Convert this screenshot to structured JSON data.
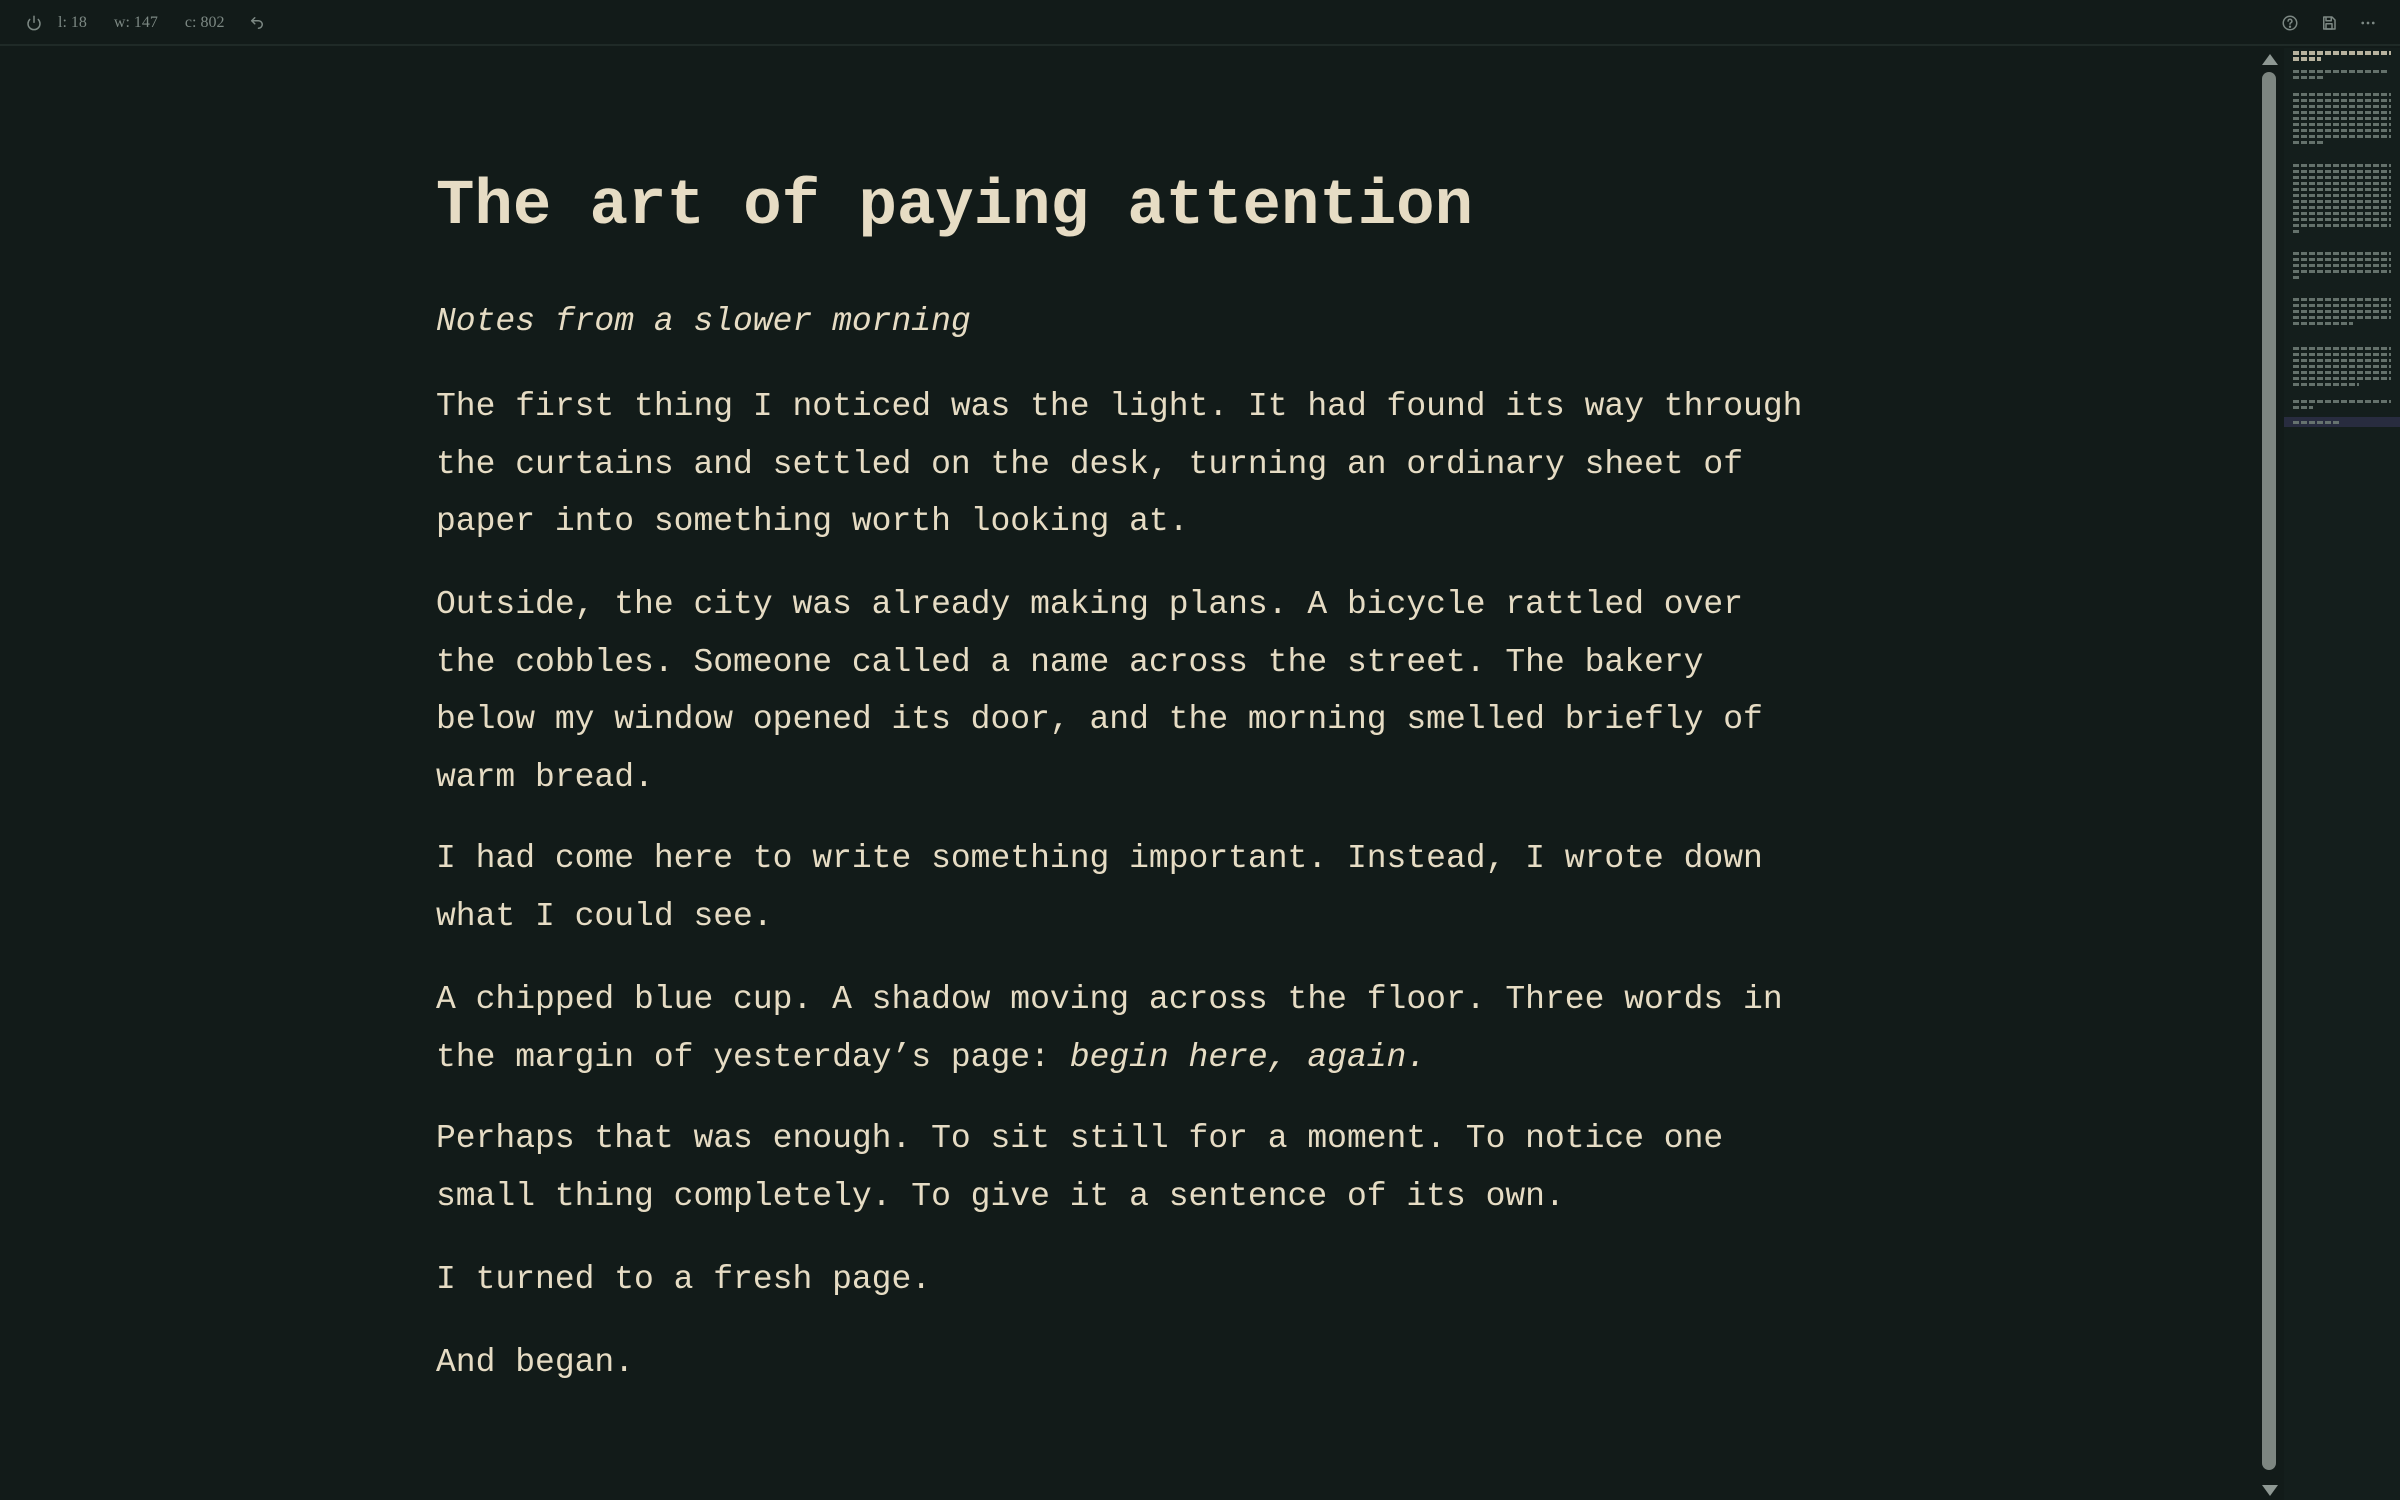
{
  "status": {
    "lines": "l: 18",
    "words": "w: 147",
    "chars": "c: 802"
  },
  "icons": {
    "power": "power-icon",
    "undo": "undo-icon",
    "help": "help-icon",
    "save": "save-icon",
    "more": "more-icon"
  },
  "colors": {
    "background": "#121b19",
    "text": "#e6dcc4",
    "muted": "#7c8883"
  },
  "document": {
    "title": "The art of paying attention",
    "subtitle": "Notes from a slower morning",
    "paragraphs": [
      {
        "lines": [
          "The first thing I noticed was the light. It had found its way through",
          "the curtains and settled on the desk, turning an ordinary sheet of",
          "paper into something worth looking at."
        ]
      },
      {
        "lines": [
          "Outside, the city was already making plans. A bicycle rattled over",
          "the cobbles. Someone called a name across the street. The bakery",
          "below my window opened its door, and the morning smelled briefly of",
          "warm bread."
        ]
      },
      {
        "lines": [
          "I had come here to write something important. Instead, I wrote down",
          "what I could see."
        ]
      },
      {
        "lines": [
          "A chipped blue cup. A shadow moving across the floor. Three words in"
        ],
        "last_line_plain": "the margin of yesterday’s page: ",
        "last_line_italic": "begin here, again."
      },
      {
        "lines": [
          "Perhaps that was enough. To sit still for a moment. To notice one",
          "small thing completely. To give it a sentence of its own."
        ]
      },
      {
        "lines": [
          "I turned to a fresh page."
        ]
      },
      {
        "lines": [
          "And began."
        ]
      }
    ]
  }
}
